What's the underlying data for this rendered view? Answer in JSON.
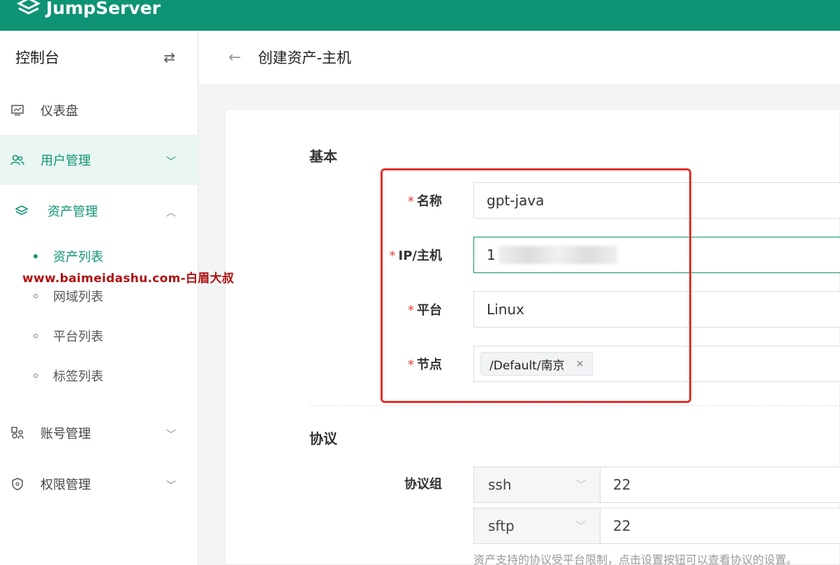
{
  "brand": {
    "name": "JumpServer",
    "color": "#0e9474"
  },
  "sidebar": {
    "title": "控制台",
    "switch_icon": "⇄",
    "items": [
      {
        "label": "仪表盘",
        "icon": "dashboard-icon"
      },
      {
        "label": "用户管理",
        "icon": "users-icon",
        "state": "collapsed"
      },
      {
        "label": "资产管理",
        "icon": "layers-icon",
        "state": "expanded"
      },
      {
        "label": "账号管理",
        "icon": "account-icon",
        "state": "collapsed"
      },
      {
        "label": "权限管理",
        "icon": "shield-icon",
        "state": "collapsed"
      }
    ],
    "asset_sub_items": [
      {
        "label": "资产列表",
        "active": true
      },
      {
        "label": "网域列表"
      },
      {
        "label": "平台列表"
      },
      {
        "label": "标签列表"
      }
    ]
  },
  "watermark": "www.baimeidashu.com-白眉大叔",
  "page": {
    "back_icon": "←",
    "title": "创建资产-主机"
  },
  "form": {
    "basic_section": "基本",
    "fields": {
      "name": {
        "label": "名称",
        "value": "gpt-java"
      },
      "ip": {
        "label": "IP/主机",
        "value": "1"
      },
      "platform": {
        "label": "平台",
        "value": "Linux"
      },
      "node": {
        "label": "节点",
        "tag": "/Default/南京",
        "tag_close": "×"
      }
    },
    "required_mark": "*",
    "protocol_section": "协议",
    "protocol_group_label": "协议组",
    "protocols": [
      {
        "name": "ssh",
        "port": "22"
      },
      {
        "name": "sftp",
        "port": "22"
      }
    ],
    "protocol_hint": "资产支持的协议受平台限制，点击设置按钮可以查看协议的设置。"
  }
}
